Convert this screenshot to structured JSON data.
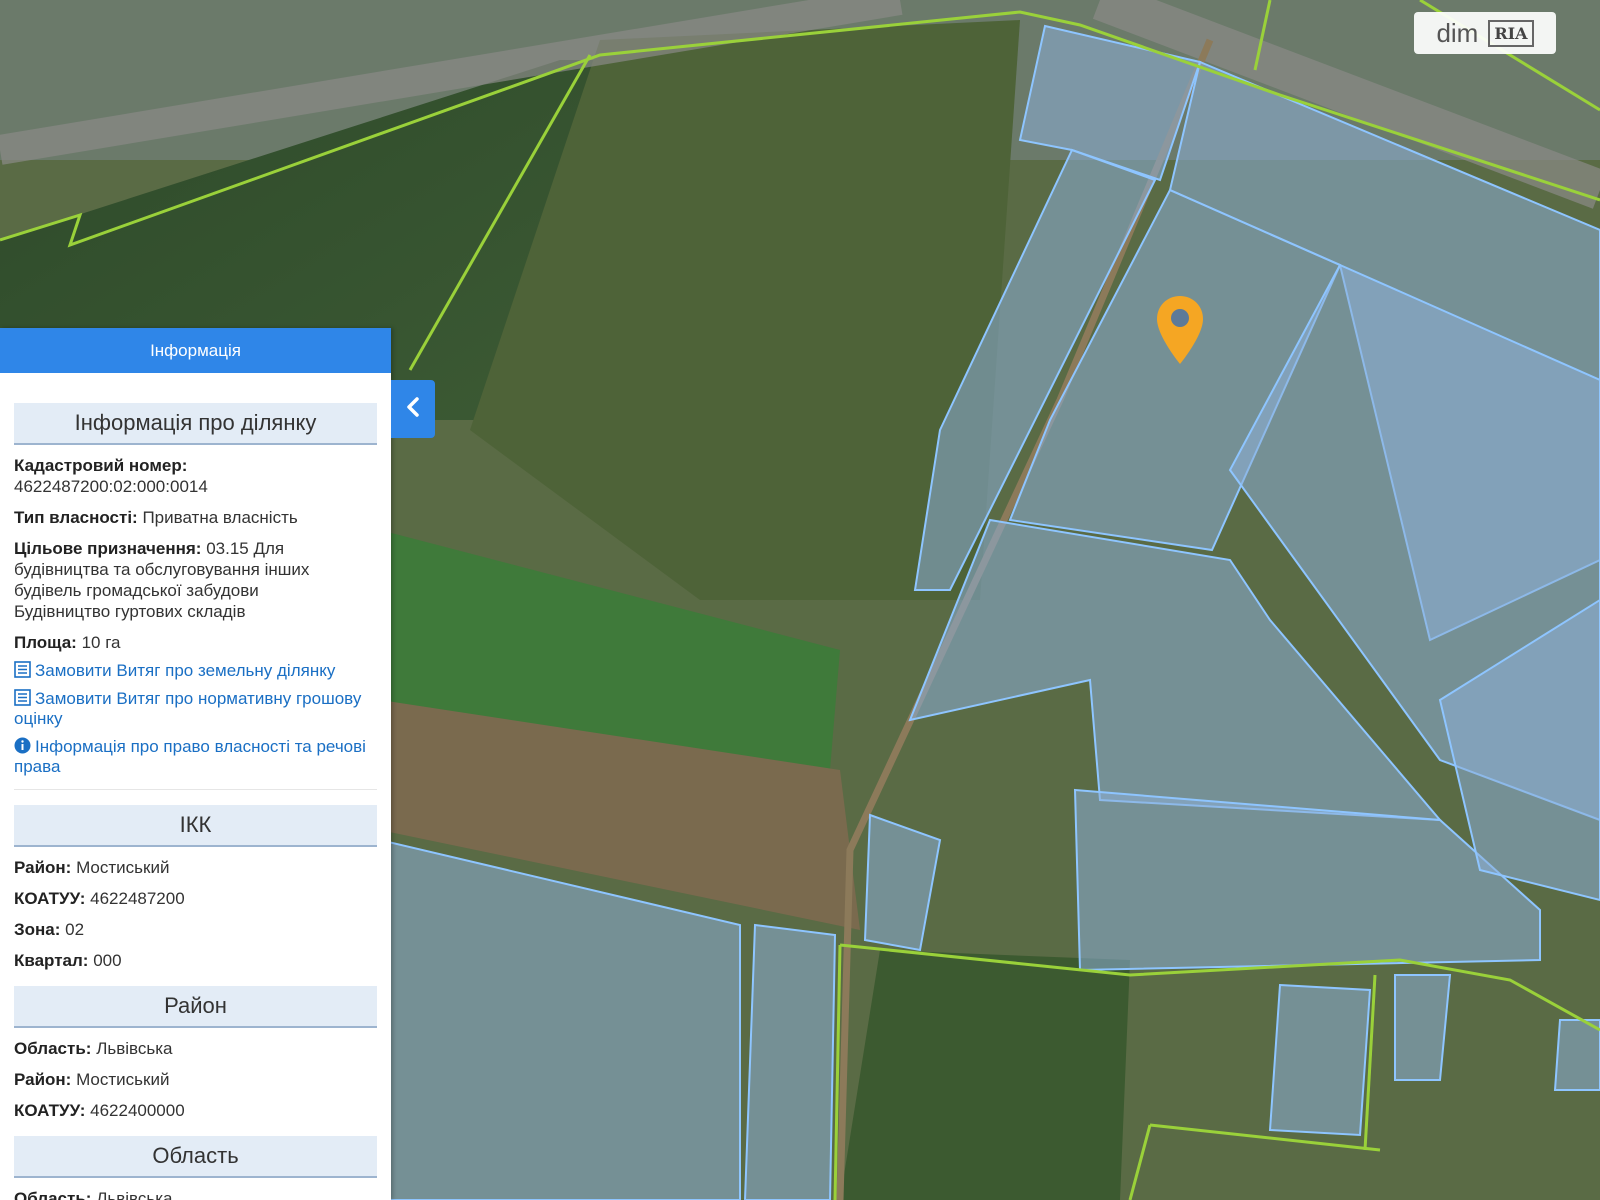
{
  "colors": {
    "panel_header": "#2f86e8",
    "link": "#1a6fc4",
    "parcel_fill": "rgba(140,175,215,0.55)",
    "parcel_stroke": "#8ec5ff",
    "boundary": "#9ad13a",
    "pin": "#f5a623"
  },
  "panel": {
    "header": "Інформація",
    "parcel_section": {
      "title": "Інформація про ділянку",
      "cadastral_label": "Кадастровий номер:",
      "cadastral_value": "4622487200:02:000:0014",
      "ownership_label": "Тип власності:",
      "ownership_value": "Приватна власність",
      "purpose_label": "Цільове призначення:",
      "purpose_value": "03.15 Для будівництва та обслуговування інших будівель громадської забудови",
      "purpose_extra": "Будівництво гуртових складів",
      "area_label": "Площа:",
      "area_value": "10 га",
      "links": [
        {
          "icon": "document-list-icon",
          "text": "Замовити Витяг про земельну ділянку"
        },
        {
          "icon": "document-list-icon",
          "text": "Замовити Витяг про нормативну грошову оцінку"
        },
        {
          "icon": "info-icon",
          "text": "Інформація про право власності та речові права"
        }
      ]
    },
    "ikk_section": {
      "title": "ІКК",
      "rows": [
        {
          "label": "Район:",
          "value": "Мостиський"
        },
        {
          "label": "КОАТУУ:",
          "value": "4622487200"
        },
        {
          "label": "Зона:",
          "value": "02"
        },
        {
          "label": "Квартал:",
          "value": "000"
        }
      ]
    },
    "district_section": {
      "title": "Район",
      "rows": [
        {
          "label": "Область:",
          "value": "Львівська"
        },
        {
          "label": "Район:",
          "value": "Мостиський"
        },
        {
          "label": "КОАТУУ:",
          "value": "4622400000"
        }
      ]
    },
    "oblast_section": {
      "title": "Область",
      "rows": [
        {
          "label": "Область:",
          "value": "Львівська"
        }
      ]
    }
  },
  "badge": {
    "text": "dim",
    "logo_text": "RIA"
  },
  "icons": {
    "collapse": "chevron-left-icon",
    "pin": "map-pin-icon"
  }
}
